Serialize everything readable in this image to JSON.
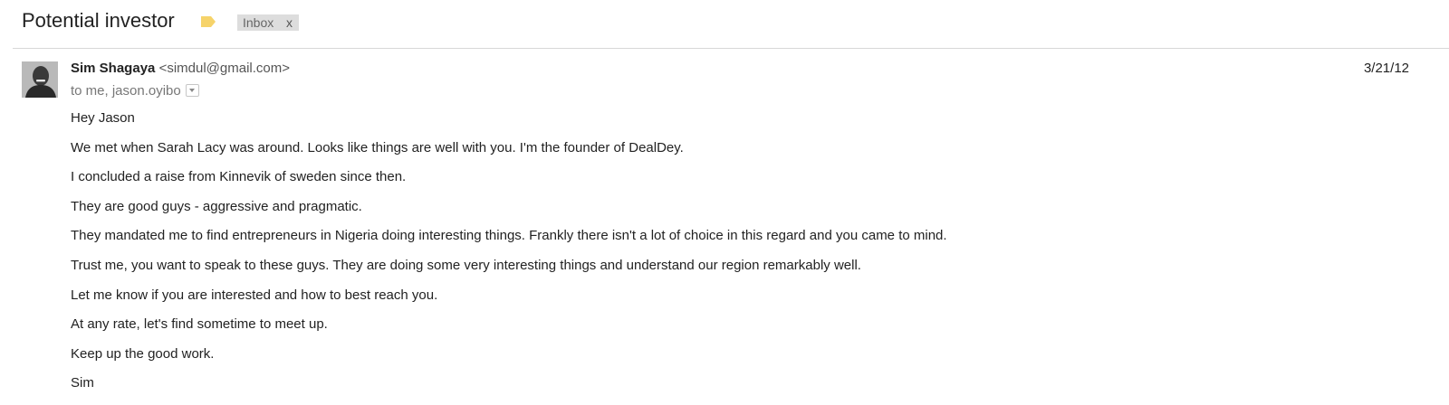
{
  "thread": {
    "subject": "Potential investor",
    "label": "Inbox",
    "label_remove": "x",
    "important_color": "#f6d36a"
  },
  "message": {
    "sender_name": "Sim Shagaya",
    "sender_email": "<simdul@gmail.com>",
    "date": "3/21/12",
    "recipients": "to me, jason.oyibo",
    "body": [
      "Hey Jason",
      "We met when Sarah Lacy was around. Looks like things are well with you. I'm the founder of DealDey.",
      "I concluded a raise from Kinnevik of sweden since then.",
      "They are good guys - aggressive and pragmatic.",
      "They mandated me to find entrepreneurs in Nigeria doing interesting things. Frankly there isn't a lot of choice in this regard and you came to mind.",
      "Trust me, you want to speak to these guys. They are doing some very interesting things and understand our region remarkably well.",
      "Let me know if you are interested and how to best reach you.",
      "At any rate, let's find sometime to meet up.",
      "Keep up the good work.",
      "Sim"
    ]
  }
}
